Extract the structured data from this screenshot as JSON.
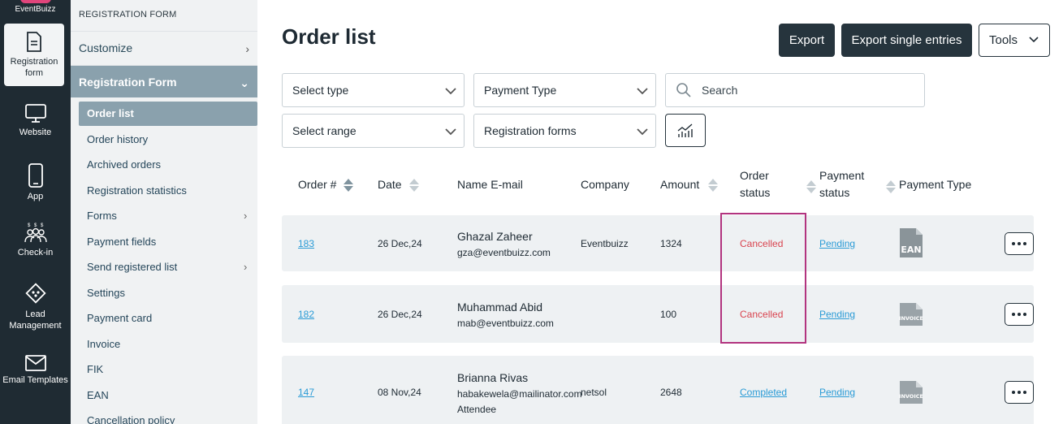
{
  "rail": {
    "brand": "EventBuizz",
    "items": [
      {
        "label": "Registration form",
        "icon": "document-icon",
        "active": true
      },
      {
        "label": "Website",
        "icon": "monitor-icon"
      },
      {
        "label": "App",
        "icon": "phone-icon"
      },
      {
        "label": "Check-in",
        "icon": "people-icon"
      },
      {
        "label": "Lead Management",
        "icon": "lead-icon"
      },
      {
        "label": "Email Templates",
        "icon": "envelope-icon"
      }
    ]
  },
  "sidebar": {
    "title": "REGISTRATION FORM",
    "sections": [
      {
        "label": "Customize"
      },
      {
        "label": "Registration Form"
      }
    ],
    "items": [
      {
        "label": "Order list"
      },
      {
        "label": "Order history"
      },
      {
        "label": "Archived orders"
      },
      {
        "label": "Registration statistics"
      },
      {
        "label": "Forms"
      },
      {
        "label": "Payment fields"
      },
      {
        "label": "Send registered list"
      },
      {
        "label": "Settings"
      },
      {
        "label": "Payment card"
      },
      {
        "label": "Invoice"
      },
      {
        "label": "FIK"
      },
      {
        "label": "EAN"
      },
      {
        "label": "Cancellation policy"
      }
    ]
  },
  "header": {
    "title": "Order list",
    "export": "Export",
    "export_single": "Export single entries",
    "tools": "Tools"
  },
  "filters": {
    "select_type": "Select type",
    "payment_type": "Payment Type",
    "search_placeholder": "Search",
    "select_range": "Select range",
    "registration_forms": "Registration forms"
  },
  "table": {
    "columns": {
      "order": "Order #",
      "date": "Date",
      "name_email": "Name E-mail",
      "company": "Company",
      "amount": "Amount",
      "order_status_1": "Order",
      "order_status_2": "status",
      "payment_status_1": "Payment",
      "payment_status_2": "status",
      "payment_type": "Payment Type"
    },
    "rows": [
      {
        "order": "183",
        "date": "26 Dec,24",
        "name": "Ghazal Zaheer",
        "email": "gza@eventbuizz.com",
        "company": "Eventbuizz",
        "amount": "1324",
        "order_status": "Cancelled",
        "payment_status": "Pending",
        "payment_type": "EAN"
      },
      {
        "order": "182",
        "date": "26 Dec,24",
        "name": "Muhammad Abid",
        "email": "mab@eventbuizz.com",
        "company": "",
        "amount": "100",
        "order_status": "Cancelled",
        "payment_status": "Pending",
        "payment_type": "INVOICE"
      },
      {
        "order": "147",
        "date": "08 Nov,24",
        "name": "Brianna Rivas",
        "email": "habakewela@mailinator.com",
        "role": "Attendee",
        "company": "netsol",
        "amount": "2648",
        "order_status": "Completed",
        "payment_status": "Pending",
        "payment_type": "INVOICE"
      }
    ]
  },
  "colors": {
    "rail_bg": "#1f2b33",
    "sidebar_bg": "#f0f2f3",
    "sidebar_active": "#8aa1ad",
    "link": "#2a9bd6",
    "cancelled": "#d9434e",
    "highlight": "#b2347f"
  }
}
